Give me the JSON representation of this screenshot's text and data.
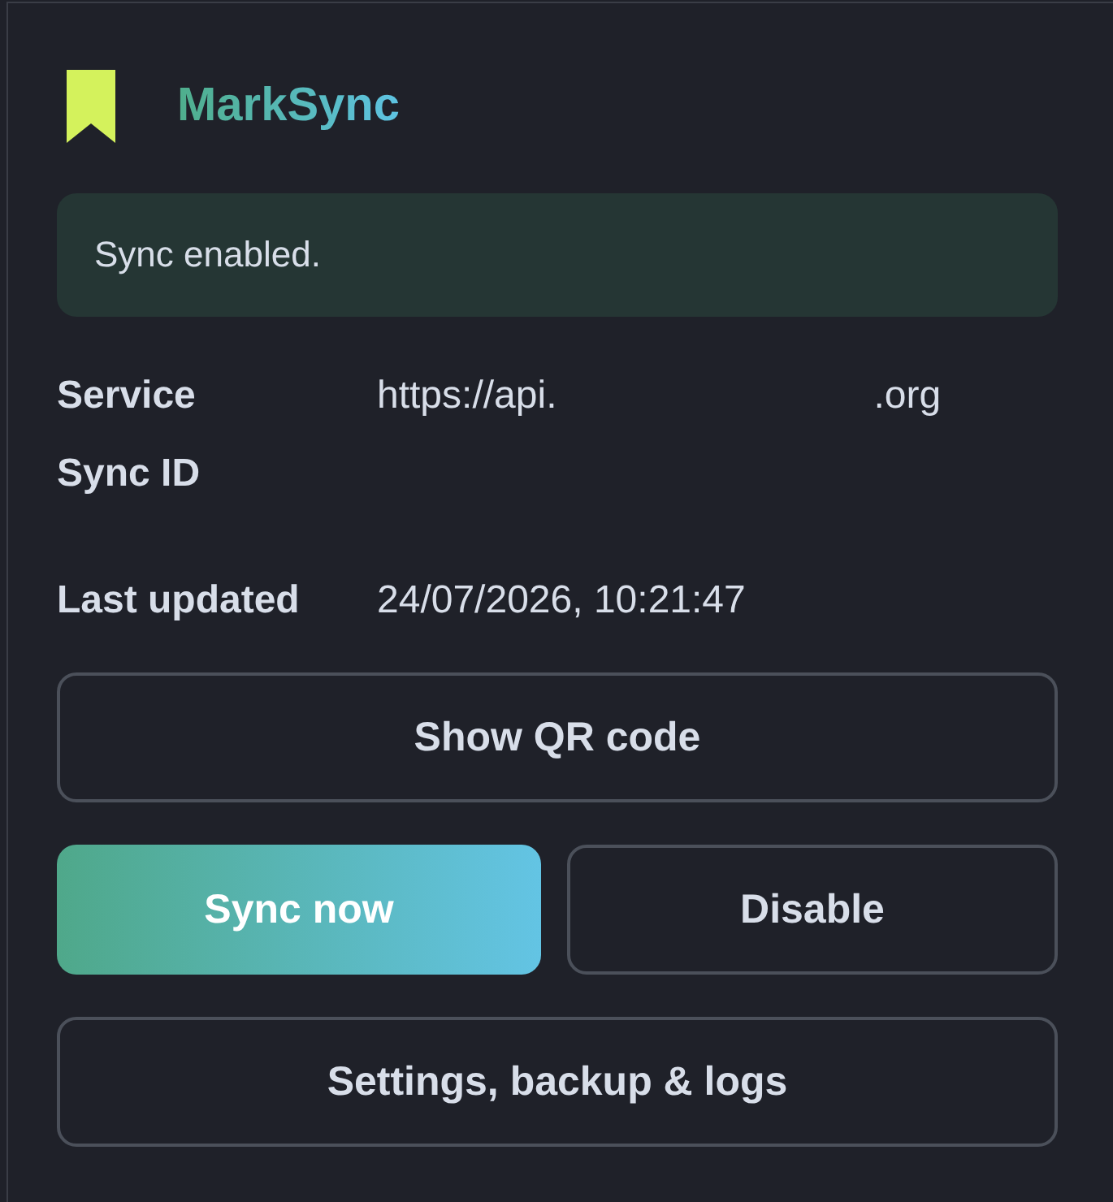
{
  "header": {
    "title": "MarkSync"
  },
  "status_banner": {
    "text": "Sync enabled."
  },
  "details": [
    {
      "label": "Service",
      "value_parts": [
        "https://api.",
        ".org"
      ]
    },
    {
      "label": "Sync ID"
    },
    {
      "label": "Last updated",
      "value_parts": [
        "24/07/2026, 10:21:47"
      ]
    }
  ],
  "button_rows": [
    [
      {
        "label": "Show QR code",
        "kind": "secondary"
      }
    ],
    [
      {
        "label": "Sync now",
        "kind": "primary"
      },
      {
        "label": "Disable",
        "kind": "secondary"
      }
    ],
    [
      {
        "label": "Settings, backup & logs",
        "kind": "secondary"
      }
    ]
  ]
}
